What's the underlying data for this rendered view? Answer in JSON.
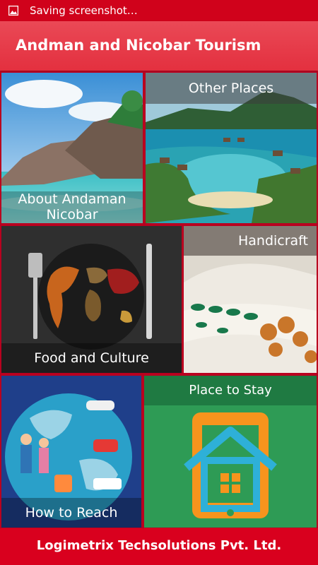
{
  "status_bar": {
    "text": "Saving screenshot…",
    "icon": "image-icon"
  },
  "app_bar": {
    "title": "Andman and Nicobar Tourism"
  },
  "tiles": [
    {
      "label": "About  Andaman Nicobar"
    },
    {
      "label": "Other Places"
    },
    {
      "label": "Food and Culture"
    },
    {
      "label": "Handicraft"
    },
    {
      "label": "How to Reach"
    },
    {
      "label": "Place to Stay"
    }
  ],
  "footer": {
    "text": "Logimetrix Techsolutions Pvt. Ltd."
  },
  "colors": {
    "primary": "#e53544",
    "frame": "#b9001f",
    "stay_green": "#2e9b55"
  }
}
